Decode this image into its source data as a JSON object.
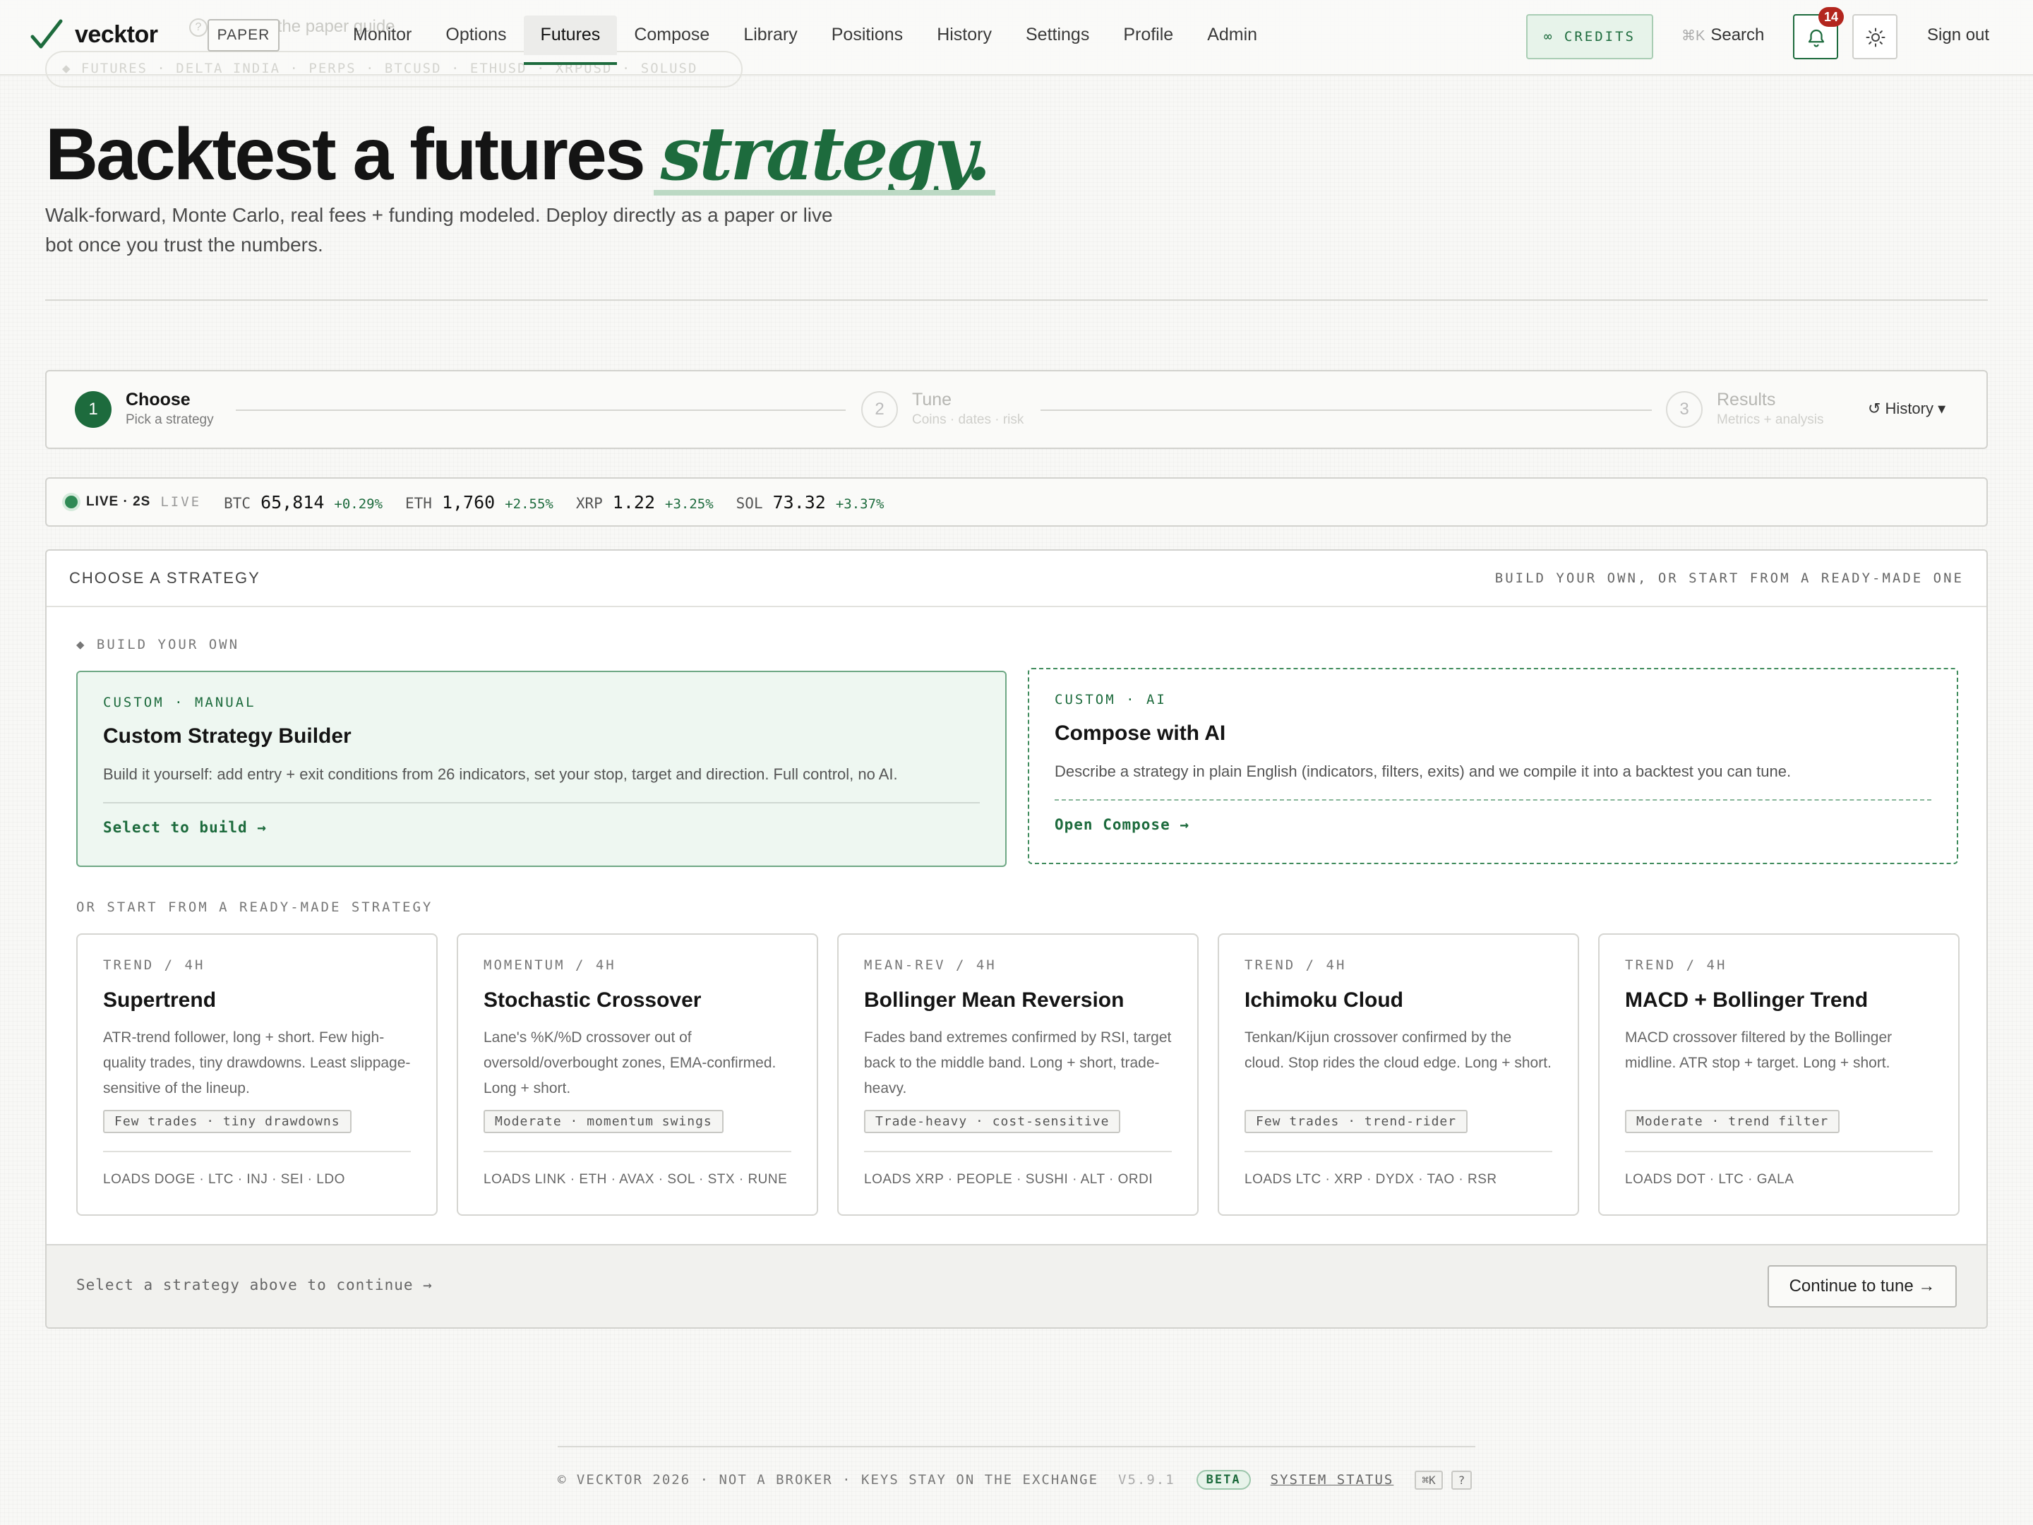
{
  "nav": {
    "logo": "vecktor",
    "mode_badge": "PAPER",
    "ghost_hint": "re? See the paper guide",
    "ghost_ticker": "◆ FUTURES · DELTA INDIA · PERPS · BTCUSD · ETHUSD · XRPUSD · SOLUSD",
    "links": [
      "Monitor",
      "Options",
      "Futures",
      "Compose",
      "Library",
      "Positions",
      "History",
      "Settings",
      "Profile",
      "Admin"
    ],
    "active": "Futures",
    "credits": "∞ CREDITS",
    "search_key": "⌘K",
    "search_label": "Search",
    "notifications": "14",
    "signout": "Sign out"
  },
  "hero": {
    "title": "Backtest a futures",
    "title_accent": "strategy.",
    "subtitle": "Walk-forward, Monte Carlo, real fees + funding modeled. Deploy directly as a paper or live bot once you trust the numbers."
  },
  "stepper": {
    "steps": [
      {
        "num": "1",
        "title": "Choose",
        "sub": "Pick a strategy"
      },
      {
        "num": "2",
        "title": "Tune",
        "sub": "Coins · dates · risk"
      },
      {
        "num": "3",
        "title": "Results",
        "sub": "Metrics + analysis"
      }
    ],
    "history": "↺ History ▾"
  },
  "live": {
    "label": "LIVE · 2S",
    "label2": "LIVE",
    "tickers": [
      {
        "sym": "BTC",
        "price": "65,814",
        "chg": "+0.29%"
      },
      {
        "sym": "ETH",
        "price": "1,760",
        "chg": "+2.55%"
      },
      {
        "sym": "XRP",
        "price": "1.22",
        "chg": "+3.25%"
      },
      {
        "sym": "SOL",
        "price": "73.32",
        "chg": "+3.37%"
      }
    ]
  },
  "panel": {
    "title": "CHOOSE A STRATEGY",
    "subtitle": "BUILD YOUR OWN, OR START FROM A READY-MADE ONE",
    "build_label": "◆ BUILD YOUR OWN",
    "manual": {
      "tag": "CUSTOM · MANUAL",
      "title": "Custom Strategy Builder",
      "desc": "Build it yourself: add entry + exit conditions from 26 indicators, set your stop, target and direction. Full control, no AI.",
      "link": "Select to build →"
    },
    "ai": {
      "tag": "CUSTOM · AI",
      "title": "Compose with AI",
      "desc": "Describe a strategy in plain English (indicators, filters, exits) and we compile it into a backtest you can tune.",
      "link": "Open Compose →"
    },
    "ready_label": "OR START FROM A READY-MADE STRATEGY",
    "strategies": [
      {
        "tag": "TREND / 4H",
        "title": "Supertrend",
        "desc": "ATR-trend follower, long + short. Few high-quality trades, tiny drawdowns. Least slippage-sensitive of the lineup.",
        "pill": "Few trades · tiny drawdowns",
        "loads": "LOADS DOGE · LTC · INJ · SEI · LDO"
      },
      {
        "tag": "MOMENTUM / 4H",
        "title": "Stochastic Crossover",
        "desc": "Lane's %K/%D crossover out of oversold/overbought zones, EMA-confirmed. Long + short.",
        "pill": "Moderate · momentum swings",
        "loads": "LOADS LINK · ETH · AVAX · SOL · STX · RUNE"
      },
      {
        "tag": "MEAN-REV / 4H",
        "title": "Bollinger Mean Reversion",
        "desc": "Fades band extremes confirmed by RSI, target back to the middle band. Long + short, trade-heavy.",
        "pill": "Trade-heavy · cost-sensitive",
        "loads": "LOADS XRP · PEOPLE · SUSHI · ALT · ORDI"
      },
      {
        "tag": "TREND / 4H",
        "title": "Ichimoku Cloud",
        "desc": "Tenkan/Kijun crossover confirmed by the cloud. Stop rides the cloud edge. Long + short.",
        "pill": "Few trades · trend-rider",
        "loads": "LOADS LTC · XRP · DYDX · TAO · RSR"
      },
      {
        "tag": "TREND / 4H",
        "title": "MACD + Bollinger Trend",
        "desc": "MACD crossover filtered by the Bollinger midline. ATR stop + target. Long + short.",
        "pill": "Moderate · trend filter",
        "loads": "LOADS DOT · LTC · GALA"
      }
    ],
    "footer_hint": "Select a strategy above to continue →",
    "continue": "Continue to tune →"
  },
  "footer": {
    "text": "© VECKTOR 2026 · NOT A BROKER · KEYS STAY ON THE EXCHANGE",
    "version": "V5.9.1",
    "beta": "BETA",
    "status": "SYSTEM STATUS",
    "kbd": "⌘K",
    "help": "?"
  },
  "colors": {
    "accent": "#1d6b3d",
    "accent_light": "#e7f3ea",
    "alert": "#b3261e"
  }
}
